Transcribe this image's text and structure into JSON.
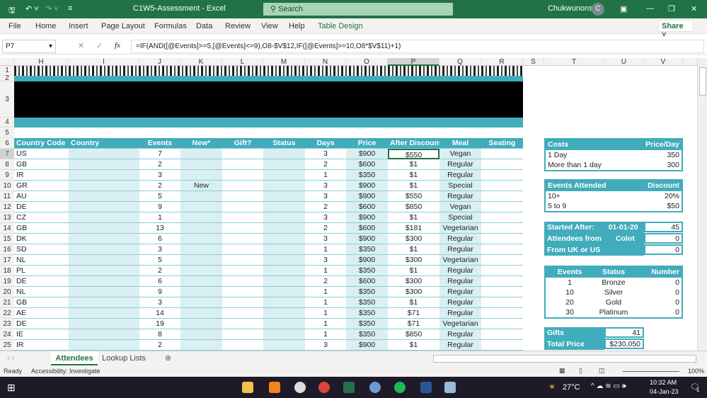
{
  "titlebar": {
    "doc_title": "C1W5-Assessment  -  Excel",
    "search_placeholder": "Search",
    "user": "Chukwunonso",
    "user_initial": "C"
  },
  "ribbon": {
    "tabs": [
      "File",
      "Home",
      "Insert",
      "Page Layout",
      "Formulas",
      "Data",
      "Review",
      "View",
      "Help",
      "Table Design"
    ],
    "share": "Share"
  },
  "formula_bar": {
    "name_box": "P7",
    "fx": "fx",
    "formula": "=IF(AND([@Events]>=5,[@Events]<=9),O8-$V$12,IF([@Events]>=10,O8*$V$11)+1)"
  },
  "columns": [
    "H",
    "I",
    "J",
    "K",
    "L",
    "M",
    "N",
    "O",
    "P",
    "Q",
    "R",
    "S",
    "T",
    "U",
    "V"
  ],
  "rows": [
    "1",
    "2",
    "3",
    "4",
    "5",
    "6",
    "7",
    "8",
    "9",
    "10",
    "11",
    "12",
    "13",
    "14",
    "15",
    "16",
    "17",
    "18",
    "19",
    "20",
    "21",
    "22",
    "23",
    "24",
    "25"
  ],
  "table": {
    "headers": [
      "Country Code",
      "Country",
      "Events",
      "New*",
      "Gift?",
      "Status",
      "Days",
      "Price",
      "After Discount",
      "Meal",
      "Seating"
    ],
    "rows": [
      [
        "US",
        "",
        "7",
        "",
        "",
        "",
        "3",
        "$900",
        "$550",
        "Vegan",
        ""
      ],
      [
        "GB",
        "",
        "2",
        "",
        "",
        "",
        "2",
        "$600",
        "$1",
        "Regular",
        ""
      ],
      [
        "IR",
        "",
        "3",
        "",
        "",
        "",
        "1",
        "$350",
        "$1",
        "Regular",
        ""
      ],
      [
        "GR",
        "",
        "2",
        "New",
        "",
        "",
        "3",
        "$900",
        "$1",
        "Special",
        ""
      ],
      [
        "AU",
        "",
        "5",
        "",
        "",
        "",
        "3",
        "$900",
        "$550",
        "Regular",
        ""
      ],
      [
        "DE",
        "",
        "9",
        "",
        "",
        "",
        "2",
        "$600",
        "$850",
        "Vegan",
        ""
      ],
      [
        "CZ",
        "",
        "1",
        "",
        "",
        "",
        "3",
        "$900",
        "$1",
        "Special",
        ""
      ],
      [
        "GB",
        "",
        "13",
        "",
        "",
        "",
        "2",
        "$600",
        "$181",
        "Vegetarian",
        ""
      ],
      [
        "DK",
        "",
        "6",
        "",
        "",
        "",
        "3",
        "$900",
        "$300",
        "Regular",
        ""
      ],
      [
        "SD",
        "",
        "3",
        "",
        "",
        "",
        "1",
        "$350",
        "$1",
        "Regular",
        ""
      ],
      [
        "NL",
        "",
        "5",
        "",
        "",
        "",
        "3",
        "$900",
        "$300",
        "Vegetarian",
        ""
      ],
      [
        "PL",
        "",
        "2",
        "",
        "",
        "",
        "1",
        "$350",
        "$1",
        "Regular",
        ""
      ],
      [
        "DE",
        "",
        "6",
        "",
        "",
        "",
        "2",
        "$600",
        "$300",
        "Regular",
        ""
      ],
      [
        "NL",
        "",
        "9",
        "",
        "",
        "",
        "1",
        "$350",
        "$300",
        "Regular",
        ""
      ],
      [
        "GB",
        "",
        "3",
        "",
        "",
        "",
        "1",
        "$350",
        "$1",
        "Regular",
        ""
      ],
      [
        "AE",
        "",
        "14",
        "",
        "",
        "",
        "1",
        "$350",
        "$71",
        "Regular",
        ""
      ],
      [
        "DE",
        "",
        "19",
        "",
        "",
        "",
        "1",
        "$350",
        "$71",
        "Vegetarian",
        ""
      ],
      [
        "IE",
        "",
        "8",
        "",
        "",
        "",
        "1",
        "$350",
        "$850",
        "Regular",
        ""
      ],
      [
        "IR",
        "",
        "2",
        "",
        "",
        "",
        "3",
        "$900",
        "$1",
        "Regular",
        ""
      ]
    ]
  },
  "costs": {
    "h": [
      "Costs",
      "Price/Day"
    ],
    "rows": [
      [
        "1 Day",
        "350"
      ],
      [
        "More than 1 day",
        "300"
      ]
    ]
  },
  "discount": {
    "h": [
      "Events Attended",
      "Discount"
    ],
    "rows": [
      [
        "10+",
        "20%"
      ],
      [
        "5 to 9",
        "$50"
      ]
    ]
  },
  "stats": {
    "rows": [
      [
        "Started After:",
        "01-01-20",
        "45"
      ],
      [
        "Attendees from",
        "Colot",
        "0"
      ],
      [
        "From UK or US",
        "",
        "0"
      ]
    ]
  },
  "status_tbl": {
    "h": [
      "Events Attended",
      "Status",
      "Number"
    ],
    "rows": [
      [
        "1",
        "Bronze",
        "0"
      ],
      [
        "10",
        "Silver",
        "0"
      ],
      [
        "20",
        "Gold",
        "0"
      ],
      [
        "30",
        "Platinum",
        "0"
      ]
    ]
  },
  "totals": {
    "rows": [
      [
        "Gifts",
        "41"
      ],
      [
        "Total Price",
        "$230,050"
      ]
    ]
  },
  "sheets": [
    "Attendees",
    "Lookup Lists"
  ],
  "statusbar": {
    "ready": "Ready",
    "accessibility": "Accessibility: Investigate",
    "zoom": "100%"
  },
  "taskbar": {
    "weather": "27°C",
    "time": "10:32 AM",
    "date": "04-Jan-23",
    "notif": "1"
  },
  "colors": {
    "excel_green": "#217346",
    "teal": "#41acbb",
    "band": "#d9eff2"
  }
}
